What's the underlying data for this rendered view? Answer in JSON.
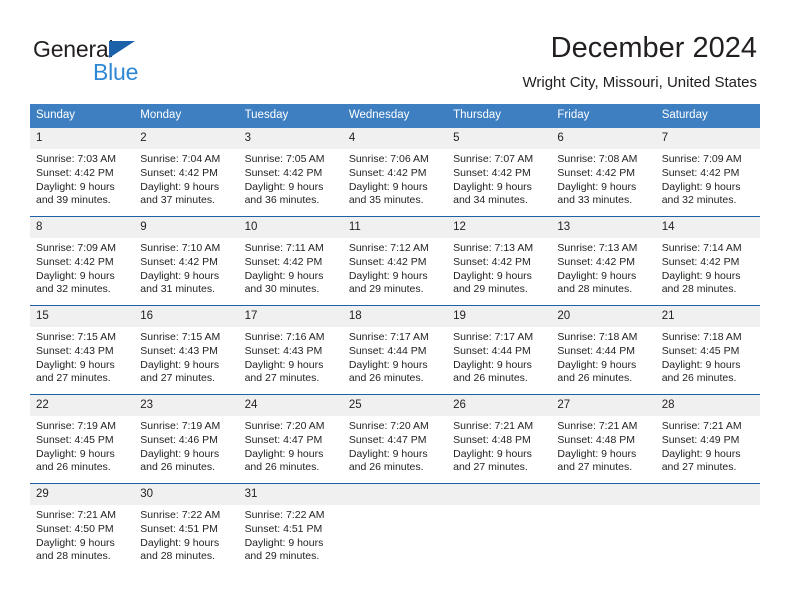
{
  "brand": {
    "name_part1": "General",
    "name_part2": "Blue",
    "colors": {
      "triangle": "#1b62ab",
      "blue_text": "#2f88d4"
    }
  },
  "header": {
    "title": "December 2024",
    "subtitle": "Wright City, Missouri, United States"
  },
  "theme": {
    "header_row_bg": "#3d7fc1",
    "row_divider": "#1b62ab",
    "daynum_bg": "#f0f0f0",
    "text": "#231f20"
  },
  "weekday_headers": [
    "Sunday",
    "Monday",
    "Tuesday",
    "Wednesday",
    "Thursday",
    "Friday",
    "Saturday"
  ],
  "labels": {
    "sunrise_prefix": "Sunrise:",
    "sunset_prefix": "Sunset:",
    "daylight_prefix": "Daylight:"
  },
  "weeks": [
    [
      {
        "day": "1",
        "sunrise": "Sunrise: 7:03 AM",
        "sunset": "Sunset: 4:42 PM",
        "daylight": "Daylight: 9 hours and 39 minutes."
      },
      {
        "day": "2",
        "sunrise": "Sunrise: 7:04 AM",
        "sunset": "Sunset: 4:42 PM",
        "daylight": "Daylight: 9 hours and 37 minutes."
      },
      {
        "day": "3",
        "sunrise": "Sunrise: 7:05 AM",
        "sunset": "Sunset: 4:42 PM",
        "daylight": "Daylight: 9 hours and 36 minutes."
      },
      {
        "day": "4",
        "sunrise": "Sunrise: 7:06 AM",
        "sunset": "Sunset: 4:42 PM",
        "daylight": "Daylight: 9 hours and 35 minutes."
      },
      {
        "day": "5",
        "sunrise": "Sunrise: 7:07 AM",
        "sunset": "Sunset: 4:42 PM",
        "daylight": "Daylight: 9 hours and 34 minutes."
      },
      {
        "day": "6",
        "sunrise": "Sunrise: 7:08 AM",
        "sunset": "Sunset: 4:42 PM",
        "daylight": "Daylight: 9 hours and 33 minutes."
      },
      {
        "day": "7",
        "sunrise": "Sunrise: 7:09 AM",
        "sunset": "Sunset: 4:42 PM",
        "daylight": "Daylight: 9 hours and 32 minutes."
      }
    ],
    [
      {
        "day": "8",
        "sunrise": "Sunrise: 7:09 AM",
        "sunset": "Sunset: 4:42 PM",
        "daylight": "Daylight: 9 hours and 32 minutes."
      },
      {
        "day": "9",
        "sunrise": "Sunrise: 7:10 AM",
        "sunset": "Sunset: 4:42 PM",
        "daylight": "Daylight: 9 hours and 31 minutes."
      },
      {
        "day": "10",
        "sunrise": "Sunrise: 7:11 AM",
        "sunset": "Sunset: 4:42 PM",
        "daylight": "Daylight: 9 hours and 30 minutes."
      },
      {
        "day": "11",
        "sunrise": "Sunrise: 7:12 AM",
        "sunset": "Sunset: 4:42 PM",
        "daylight": "Daylight: 9 hours and 29 minutes."
      },
      {
        "day": "12",
        "sunrise": "Sunrise: 7:13 AM",
        "sunset": "Sunset: 4:42 PM",
        "daylight": "Daylight: 9 hours and 29 minutes."
      },
      {
        "day": "13",
        "sunrise": "Sunrise: 7:13 AM",
        "sunset": "Sunset: 4:42 PM",
        "daylight": "Daylight: 9 hours and 28 minutes."
      },
      {
        "day": "14",
        "sunrise": "Sunrise: 7:14 AM",
        "sunset": "Sunset: 4:42 PM",
        "daylight": "Daylight: 9 hours and 28 minutes."
      }
    ],
    [
      {
        "day": "15",
        "sunrise": "Sunrise: 7:15 AM",
        "sunset": "Sunset: 4:43 PM",
        "daylight": "Daylight: 9 hours and 27 minutes."
      },
      {
        "day": "16",
        "sunrise": "Sunrise: 7:15 AM",
        "sunset": "Sunset: 4:43 PM",
        "daylight": "Daylight: 9 hours and 27 minutes."
      },
      {
        "day": "17",
        "sunrise": "Sunrise: 7:16 AM",
        "sunset": "Sunset: 4:43 PM",
        "daylight": "Daylight: 9 hours and 27 minutes."
      },
      {
        "day": "18",
        "sunrise": "Sunrise: 7:17 AM",
        "sunset": "Sunset: 4:44 PM",
        "daylight": "Daylight: 9 hours and 26 minutes."
      },
      {
        "day": "19",
        "sunrise": "Sunrise: 7:17 AM",
        "sunset": "Sunset: 4:44 PM",
        "daylight": "Daylight: 9 hours and 26 minutes."
      },
      {
        "day": "20",
        "sunrise": "Sunrise: 7:18 AM",
        "sunset": "Sunset: 4:44 PM",
        "daylight": "Daylight: 9 hours and 26 minutes."
      },
      {
        "day": "21",
        "sunrise": "Sunrise: 7:18 AM",
        "sunset": "Sunset: 4:45 PM",
        "daylight": "Daylight: 9 hours and 26 minutes."
      }
    ],
    [
      {
        "day": "22",
        "sunrise": "Sunrise: 7:19 AM",
        "sunset": "Sunset: 4:45 PM",
        "daylight": "Daylight: 9 hours and 26 minutes."
      },
      {
        "day": "23",
        "sunrise": "Sunrise: 7:19 AM",
        "sunset": "Sunset: 4:46 PM",
        "daylight": "Daylight: 9 hours and 26 minutes."
      },
      {
        "day": "24",
        "sunrise": "Sunrise: 7:20 AM",
        "sunset": "Sunset: 4:47 PM",
        "daylight": "Daylight: 9 hours and 26 minutes."
      },
      {
        "day": "25",
        "sunrise": "Sunrise: 7:20 AM",
        "sunset": "Sunset: 4:47 PM",
        "daylight": "Daylight: 9 hours and 26 minutes."
      },
      {
        "day": "26",
        "sunrise": "Sunrise: 7:21 AM",
        "sunset": "Sunset: 4:48 PM",
        "daylight": "Daylight: 9 hours and 27 minutes."
      },
      {
        "day": "27",
        "sunrise": "Sunrise: 7:21 AM",
        "sunset": "Sunset: 4:48 PM",
        "daylight": "Daylight: 9 hours and 27 minutes."
      },
      {
        "day": "28",
        "sunrise": "Sunrise: 7:21 AM",
        "sunset": "Sunset: 4:49 PM",
        "daylight": "Daylight: 9 hours and 27 minutes."
      }
    ],
    [
      {
        "day": "29",
        "sunrise": "Sunrise: 7:21 AM",
        "sunset": "Sunset: 4:50 PM",
        "daylight": "Daylight: 9 hours and 28 minutes."
      },
      {
        "day": "30",
        "sunrise": "Sunrise: 7:22 AM",
        "sunset": "Sunset: 4:51 PM",
        "daylight": "Daylight: 9 hours and 28 minutes."
      },
      {
        "day": "31",
        "sunrise": "Sunrise: 7:22 AM",
        "sunset": "Sunset: 4:51 PM",
        "daylight": "Daylight: 9 hours and 29 minutes."
      },
      {
        "day": "",
        "sunrise": "",
        "sunset": "",
        "daylight": ""
      },
      {
        "day": "",
        "sunrise": "",
        "sunset": "",
        "daylight": ""
      },
      {
        "day": "",
        "sunrise": "",
        "sunset": "",
        "daylight": ""
      },
      {
        "day": "",
        "sunrise": "",
        "sunset": "",
        "daylight": ""
      }
    ]
  ]
}
